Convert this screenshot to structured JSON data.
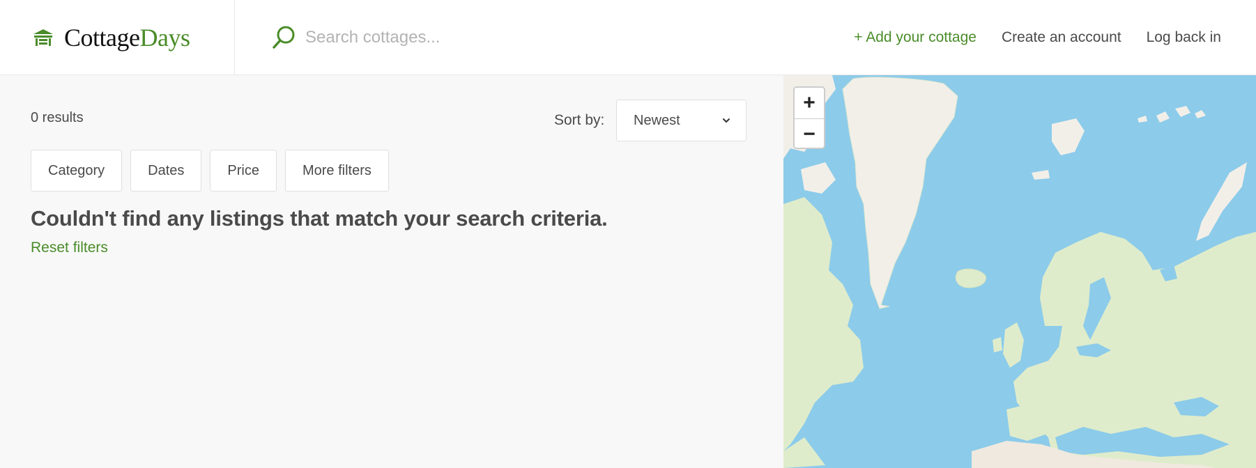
{
  "brand": {
    "name_part1": "Cottage",
    "name_part2": "Days",
    "accent_color": "#4a8c29",
    "icon": "house-icon"
  },
  "search": {
    "placeholder": "Search cottages...",
    "value": "",
    "icon": "search-icon"
  },
  "nav": {
    "add_cottage": "+ Add your cottage",
    "create_account": "Create an account",
    "log_in": "Log back in"
  },
  "results": {
    "count_label": "0 results",
    "sort": {
      "label": "Sort by:",
      "selected": "Newest"
    },
    "filters": [
      "Category",
      "Dates",
      "Price",
      "More filters"
    ],
    "empty_message": "Couldn't find any listings that match your search criteria.",
    "reset_label": "Reset filters"
  },
  "map": {
    "zoom_in": "+",
    "zoom_out": "−",
    "water_color": "#8ccbea",
    "land_color": "#f2efe9"
  }
}
